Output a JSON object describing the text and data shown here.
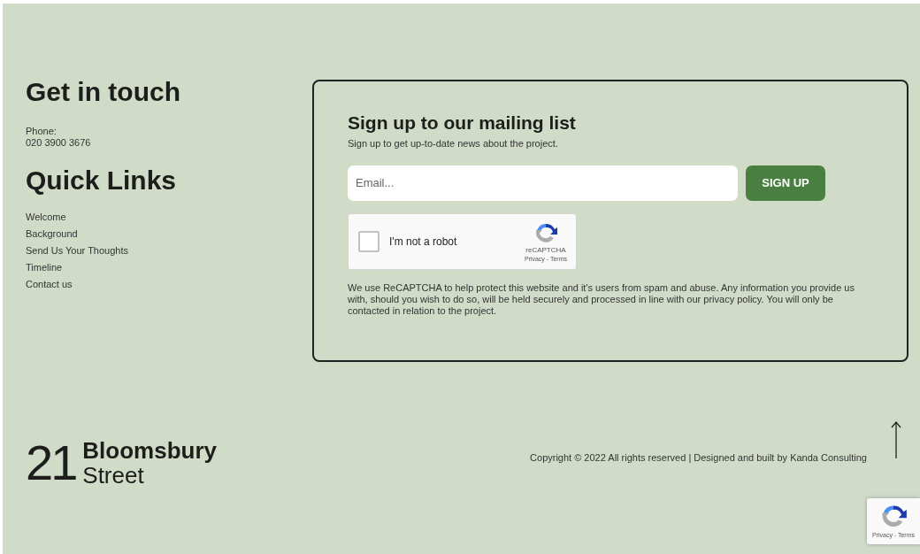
{
  "contact": {
    "heading": "Get in touch",
    "phone_label": "Phone:",
    "phone": "020 3900 3676"
  },
  "quick_links": {
    "heading": "Quick Links",
    "items": [
      "Welcome",
      "Background",
      "Send Us Your Thoughts",
      "Timeline",
      "Contact us"
    ]
  },
  "mailing": {
    "heading": "Sign up to our mailing list",
    "subtitle": "Sign up to get up-to-date news about the project.",
    "email_placeholder": "Email...",
    "button": "SIGN UP",
    "recaptcha": {
      "checked": false,
      "label": "I'm not a robot",
      "brand": "reCAPTCHA",
      "links": "Privacy - Terms"
    },
    "notice": "We use ReCAPTCHA to help protect this website and it's users from spam and abuse. Any information you provide us with, should you wish to do so, will be held securely and processed in line with our privacy policy. You will only be contacted in relation to the project."
  },
  "footer": {
    "logo_number": "21",
    "logo_line1": "Bloomsbury",
    "logo_line2": "Street",
    "copyright": "Copyright © 2022 All rights reserved | Designed and built by Kanda Consulting",
    "badge_links": "Privacy - Terms"
  }
}
